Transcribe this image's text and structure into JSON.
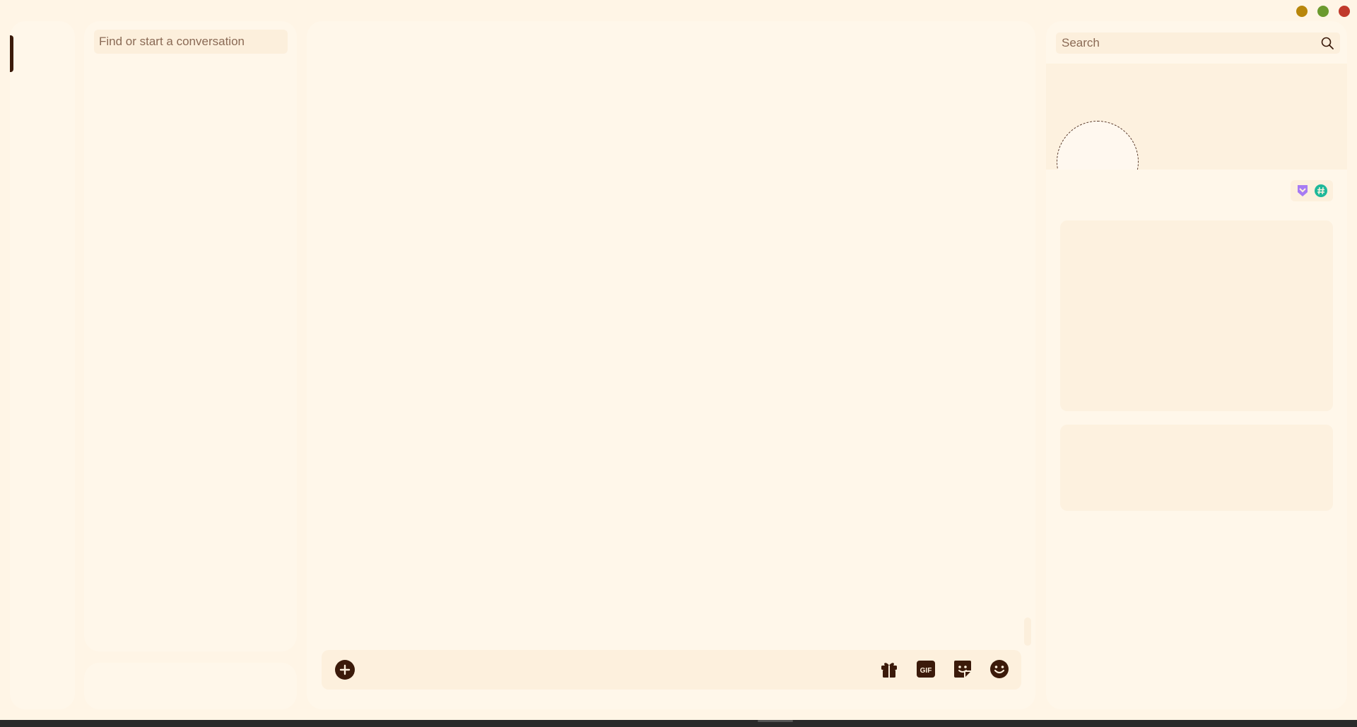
{
  "window": {
    "controls": [
      "minimize",
      "maximize",
      "close"
    ],
    "colors": {
      "minimize": "#b8860b",
      "maximize": "#6b9a2e",
      "close": "#c0392b"
    }
  },
  "dm_sidebar": {
    "search_placeholder": "Find or start a conversation"
  },
  "composer": {
    "add_icon": "plus-circle-icon",
    "tools": [
      "gift-icon",
      "gif-icon",
      "sticker-icon",
      "emoji-icon"
    ],
    "gif_label": "GIF"
  },
  "profile_panel": {
    "search_placeholder": "Search",
    "badges": [
      "nitro-badge-icon",
      "hashtag-badge-icon"
    ],
    "badge_colors": {
      "nitro": "#a77bf3",
      "hashtag": "#1fb89a"
    }
  },
  "theme": {
    "background": "#fff5e6",
    "panel": "#fff7ea",
    "accent_dark": "#3b1a0a"
  }
}
